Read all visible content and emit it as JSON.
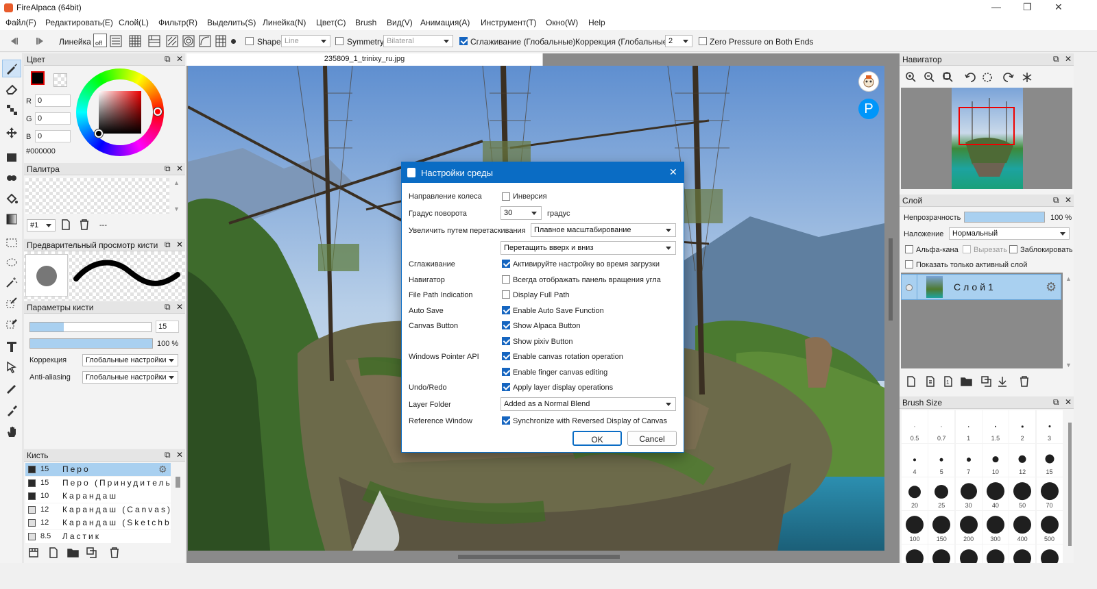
{
  "window": {
    "title": "FireAlpaca (64bit)"
  },
  "menu": [
    "Файл(F)",
    "Редактировать(E)",
    "Слой(L)",
    "Фильтр(R)",
    "Выделить(S)",
    "Линейка(N)",
    "Цвет(C)",
    "Brush",
    "Вид(V)",
    "Анимация(A)",
    "Инструмент(T)",
    "Окно(W)",
    "Help"
  ],
  "toolbar": {
    "ruler_label": "Линейка",
    "snap_off": "off",
    "shape_label": "Shape",
    "shape_value": "Line",
    "symmetry_label": "Symmetry",
    "symmetry_value": "Bilateral",
    "antialias_label": "Сглаживание (Глобальные)",
    "correction_label": "Коррекция (Глобальные)",
    "correction_value": "2",
    "zero_pressure_label": "Zero Pressure on Both Ends"
  },
  "color_panel": {
    "title": "Цвет",
    "r_label": "R",
    "r": "0",
    "g_label": "G",
    "g": "0",
    "b_label": "B",
    "b": "0",
    "hex": "#000000",
    "primary": "#000000"
  },
  "palette_panel": {
    "title": "Палитра",
    "select": "#1",
    "dash": "---"
  },
  "brush_preview_panel": {
    "title": "Предварительный просмотр кисти"
  },
  "brush_params_panel": {
    "title": "Параметры кисти",
    "size_value": "15",
    "size_fill": 0.28,
    "opacity_value": "100 %",
    "opacity_fill": 1.0,
    "correction_label": "Коррекция",
    "correction_value": "Глобальные настройки",
    "antialias_label": "Anti-aliasing",
    "antialias_value": "Глобальные настройки"
  },
  "brush_panel": {
    "title": "Кисть",
    "items": [
      {
        "size": "15",
        "name": "Перо",
        "swatch": "#2a2a2a"
      },
      {
        "size": "15",
        "name": "Перо (Принудительно)",
        "swatch": "#2a2a2a"
      },
      {
        "size": "10",
        "name": "Карандаш",
        "swatch": "#2a2a2a"
      },
      {
        "size": "12",
        "name": "Карандаш (Canvas)",
        "swatch": "#e0e0e0"
      },
      {
        "size": "12",
        "name": "Карандаш (Sketchbook)",
        "swatch": "#e0e0e0"
      },
      {
        "size": "8.5",
        "name": "Ластик",
        "swatch": "#e0e0e0"
      }
    ]
  },
  "document": {
    "tab": "235809_1_trinixy_ru.jpg"
  },
  "dialog": {
    "title": "Настройки среды",
    "rows": [
      {
        "label": "Направление колеса",
        "check": false,
        "text": "Инверсия"
      },
      {
        "label": "Градус поворота",
        "select": "30",
        "suffix": "градус"
      },
      {
        "label": "Увеличить путем перетаскивания",
        "select": "Плавное масштабирование"
      },
      {
        "label": "",
        "select": "Перетащить вверх и вниз"
      },
      {
        "label": "Сглаживание",
        "check": true,
        "text": "Активируйте настройку во время загрузки"
      },
      {
        "label": "Навигатор",
        "check": false,
        "text": "Всегда отображать панель вращения угла"
      },
      {
        "label": "File Path Indication",
        "check": false,
        "text": "Display Full Path"
      },
      {
        "label": "Auto Save",
        "check": true,
        "text": "Enable Auto Save Function"
      },
      {
        "label": "Canvas Button",
        "check": true,
        "text": "Show Alpaca Button"
      },
      {
        "label": "",
        "check": true,
        "text": "Show pixiv Button"
      },
      {
        "label": "Windows Pointer API",
        "check": true,
        "text": "Enable canvas rotation operation"
      },
      {
        "label": "",
        "check": true,
        "text": "Enable finger canvas editing"
      },
      {
        "label": "Undo/Redo",
        "check": true,
        "text": "Apply layer display operations"
      },
      {
        "label": "Layer Folder",
        "select": "Added as a Normal Blend"
      },
      {
        "label": "Reference Window",
        "check": true,
        "text": "Synchronize with Reversed Display of Canvas"
      }
    ],
    "ok": "OK",
    "cancel": "Cancel"
  },
  "navigator": {
    "title": "Навигатор"
  },
  "layer_panel": {
    "title": "Слой",
    "opacity_label": "Непрозрачность",
    "opacity_value": "100 %",
    "blend_label": "Наложение",
    "blend_value": "Нормальный",
    "alpha_label": "Альфа-кана.",
    "clip_label": "Вырезать",
    "lock_label": "Заблокировать",
    "only_active_label": "Показать только активный слой",
    "layer_name": "Слой1"
  },
  "brush_size_panel": {
    "title": "Brush Size",
    "sizes": [
      "0.5",
      "0.7",
      "1",
      "1.5",
      "2",
      "3",
      "4",
      "5",
      "7",
      "10",
      "12",
      "15",
      "20",
      "25",
      "30",
      "40",
      "50",
      "70",
      "100",
      "150",
      "200",
      "300",
      "400",
      "500"
    ]
  }
}
